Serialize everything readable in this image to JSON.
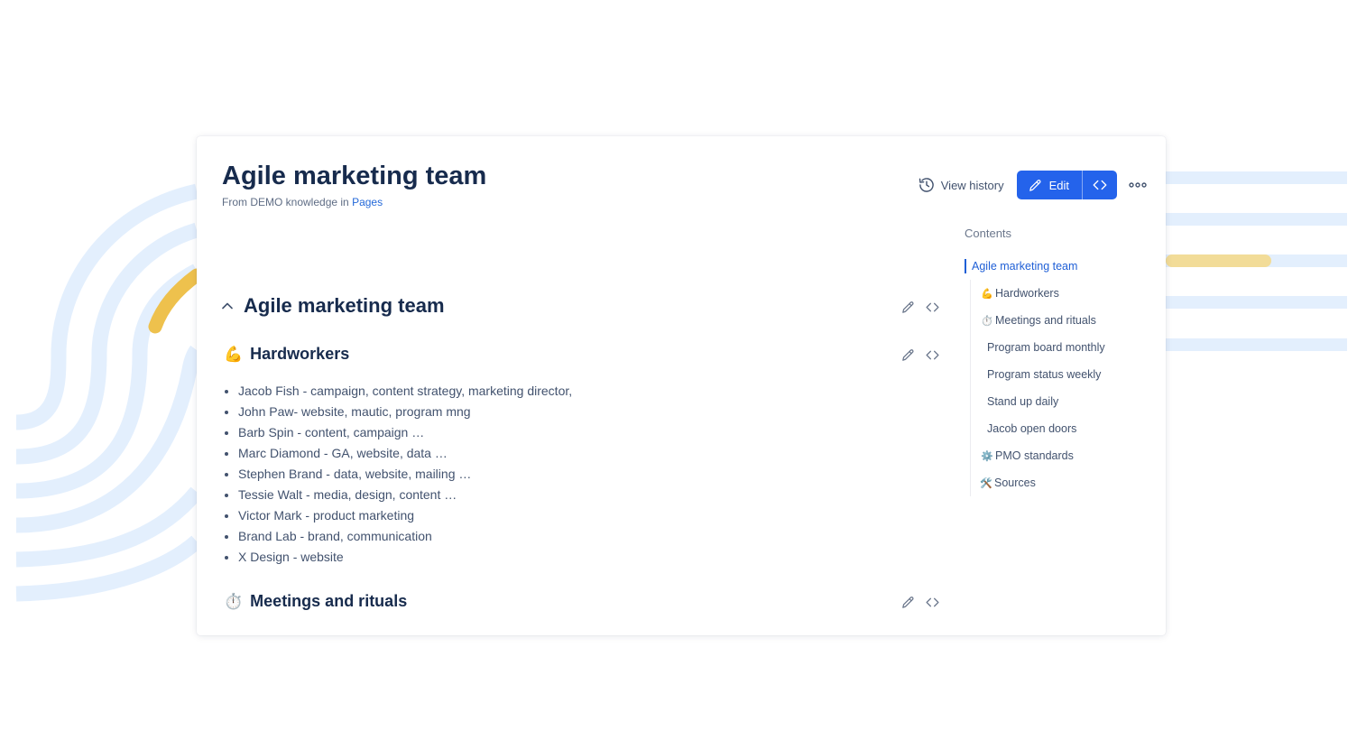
{
  "page": {
    "title": "Agile marketing team",
    "breadcrumb_prefix": "From DEMO knowledge in",
    "breadcrumb_link": "Pages"
  },
  "toolbar": {
    "view_history": "View history",
    "edit": "Edit"
  },
  "sections": {
    "main_heading": "Agile marketing team",
    "hardworkers": {
      "emoji": "💪",
      "heading": "Hardworkers"
    },
    "meetings": {
      "emoji": "⏱️",
      "heading": "Meetings and rituals"
    }
  },
  "members": [
    "Jacob Fish - campaign, content strategy, marketing director,",
    "John Paw- website, mautic, program mng",
    "Barb Spin - content, campaign …",
    "Marc Diamond - GA, website, data …",
    "Stephen Brand - data, website, mailing …",
    "Tessie Walt - media, design, content …",
    "Victor Mark - product marketing",
    "Brand Lab - brand, communication",
    "X Design - website"
  ],
  "toc": {
    "heading": "Contents",
    "items": [
      {
        "label": "Agile marketing team",
        "icon": "",
        "level": 1,
        "active": true
      },
      {
        "label": "Hardworkers",
        "icon": "💪",
        "level": 2
      },
      {
        "label": "Meetings and rituals",
        "icon": "⏱️",
        "level": 2
      },
      {
        "label": "Program board monthly",
        "icon": "",
        "level": 3
      },
      {
        "label": "Program status weekly",
        "icon": "",
        "level": 3
      },
      {
        "label": "Stand up daily",
        "icon": "",
        "level": 3
      },
      {
        "label": "Jacob open doors",
        "icon": "",
        "level": 3
      },
      {
        "label": "PMO standards",
        "icon": "⚙️",
        "level": 2
      },
      {
        "label": "Sources",
        "icon": "🛠️",
        "level": 2
      }
    ]
  },
  "icons": {
    "history": "history-icon",
    "edit": "pencil-icon",
    "embed": "code-brackets-icon",
    "more": "more-dots-icon",
    "collapse": "chevron-up-icon"
  },
  "colors": {
    "primary": "#2463eb",
    "link": "#2469d9",
    "heading": "#172b4d",
    "text": "#42526e",
    "decor_blue": "#e3effd",
    "decor_yellow": "#eec14d"
  }
}
